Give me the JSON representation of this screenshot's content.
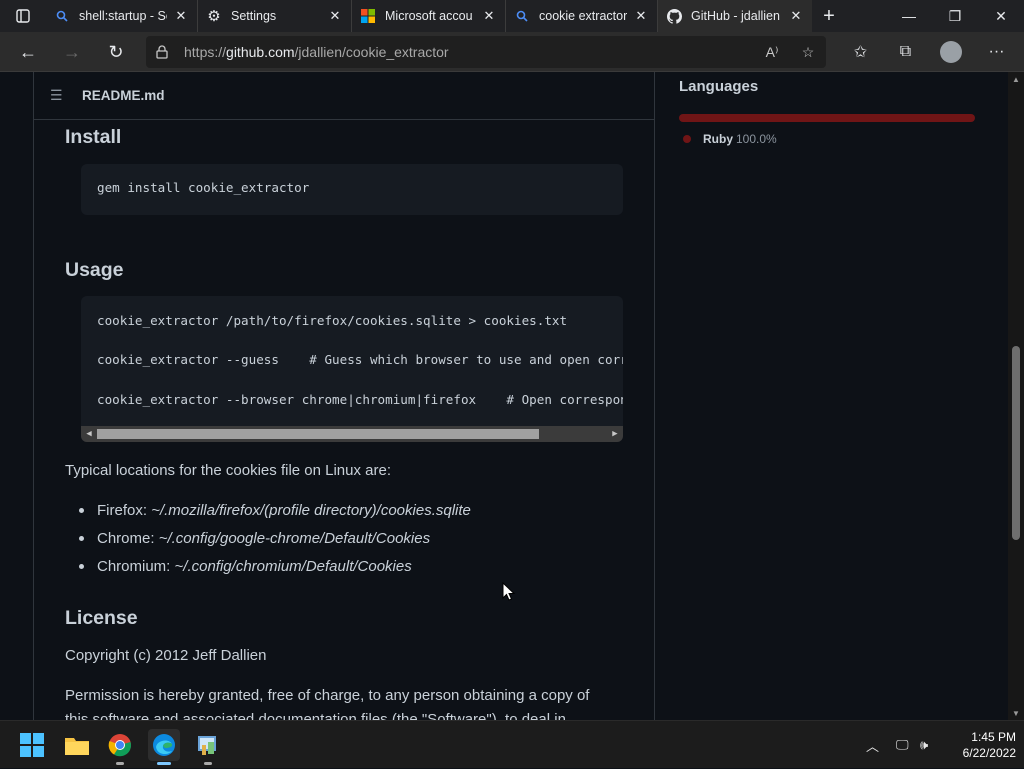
{
  "browser": {
    "tabs": [
      {
        "title": "shell:startup - Se",
        "icon": "search-icon"
      },
      {
        "title": "Settings",
        "icon": "gear-icon"
      },
      {
        "title": "Microsoft accou",
        "icon": "microsoft-logo-icon"
      },
      {
        "title": "cookie extractor",
        "icon": "search-icon"
      },
      {
        "title": "GitHub - jdallien",
        "icon": "github-icon",
        "active": true
      }
    ],
    "url_prefix": "https://",
    "url_host": "github.com",
    "url_path": "/jdallien/cookie_extractor"
  },
  "readme": {
    "filename": "README.md",
    "install_heading": "Install",
    "install_code": "gem install cookie_extractor",
    "usage_heading": "Usage",
    "usage_code": [
      "cookie_extractor /path/to/firefox/cookies.sqlite > cookies.txt",
      "cookie_extractor --guess    # Guess which browser to use and open corresp",
      "cookie_extractor --browser chrome|chromium|firefox    # Open correspondi"
    ],
    "locations_intro": "Typical locations for the cookies file on Linux are:",
    "locations": [
      {
        "browser": "Firefox:",
        "path": "~/.mozilla/firefox/(profile directory)/cookies.sqlite"
      },
      {
        "browser": "Chrome:",
        "path": "~/.config/google-chrome/Default/Cookies"
      },
      {
        "browser": "Chromium:",
        "path": "~/.config/chromium/Default/Cookies"
      }
    ],
    "license_heading": "License",
    "copyright": "Copyright (c) 2012 Jeff Dallien",
    "permission_line1": "Permission is hereby granted, free of charge, to any person obtaining a copy of",
    "permission_line2": "this software and associated documentation files (the \"Software\"), to deal in"
  },
  "sidebar": {
    "languages_title": "Languages",
    "languages": [
      {
        "name": "Ruby",
        "percent": "100.0%",
        "share": 1.0,
        "color": "#701516"
      }
    ]
  },
  "taskbar": {
    "time": "1:45 PM",
    "date": "6/22/2022",
    "apps": [
      "windows-start-icon",
      "file-explorer-icon",
      "chrome-icon",
      "edge-icon",
      "control-panel-icon"
    ]
  },
  "colors": {
    "page_bg": "#0d1117",
    "text": "#c9d1d9",
    "code_bg": "#161b22",
    "border": "#30363d",
    "ruby": "#701516"
  }
}
